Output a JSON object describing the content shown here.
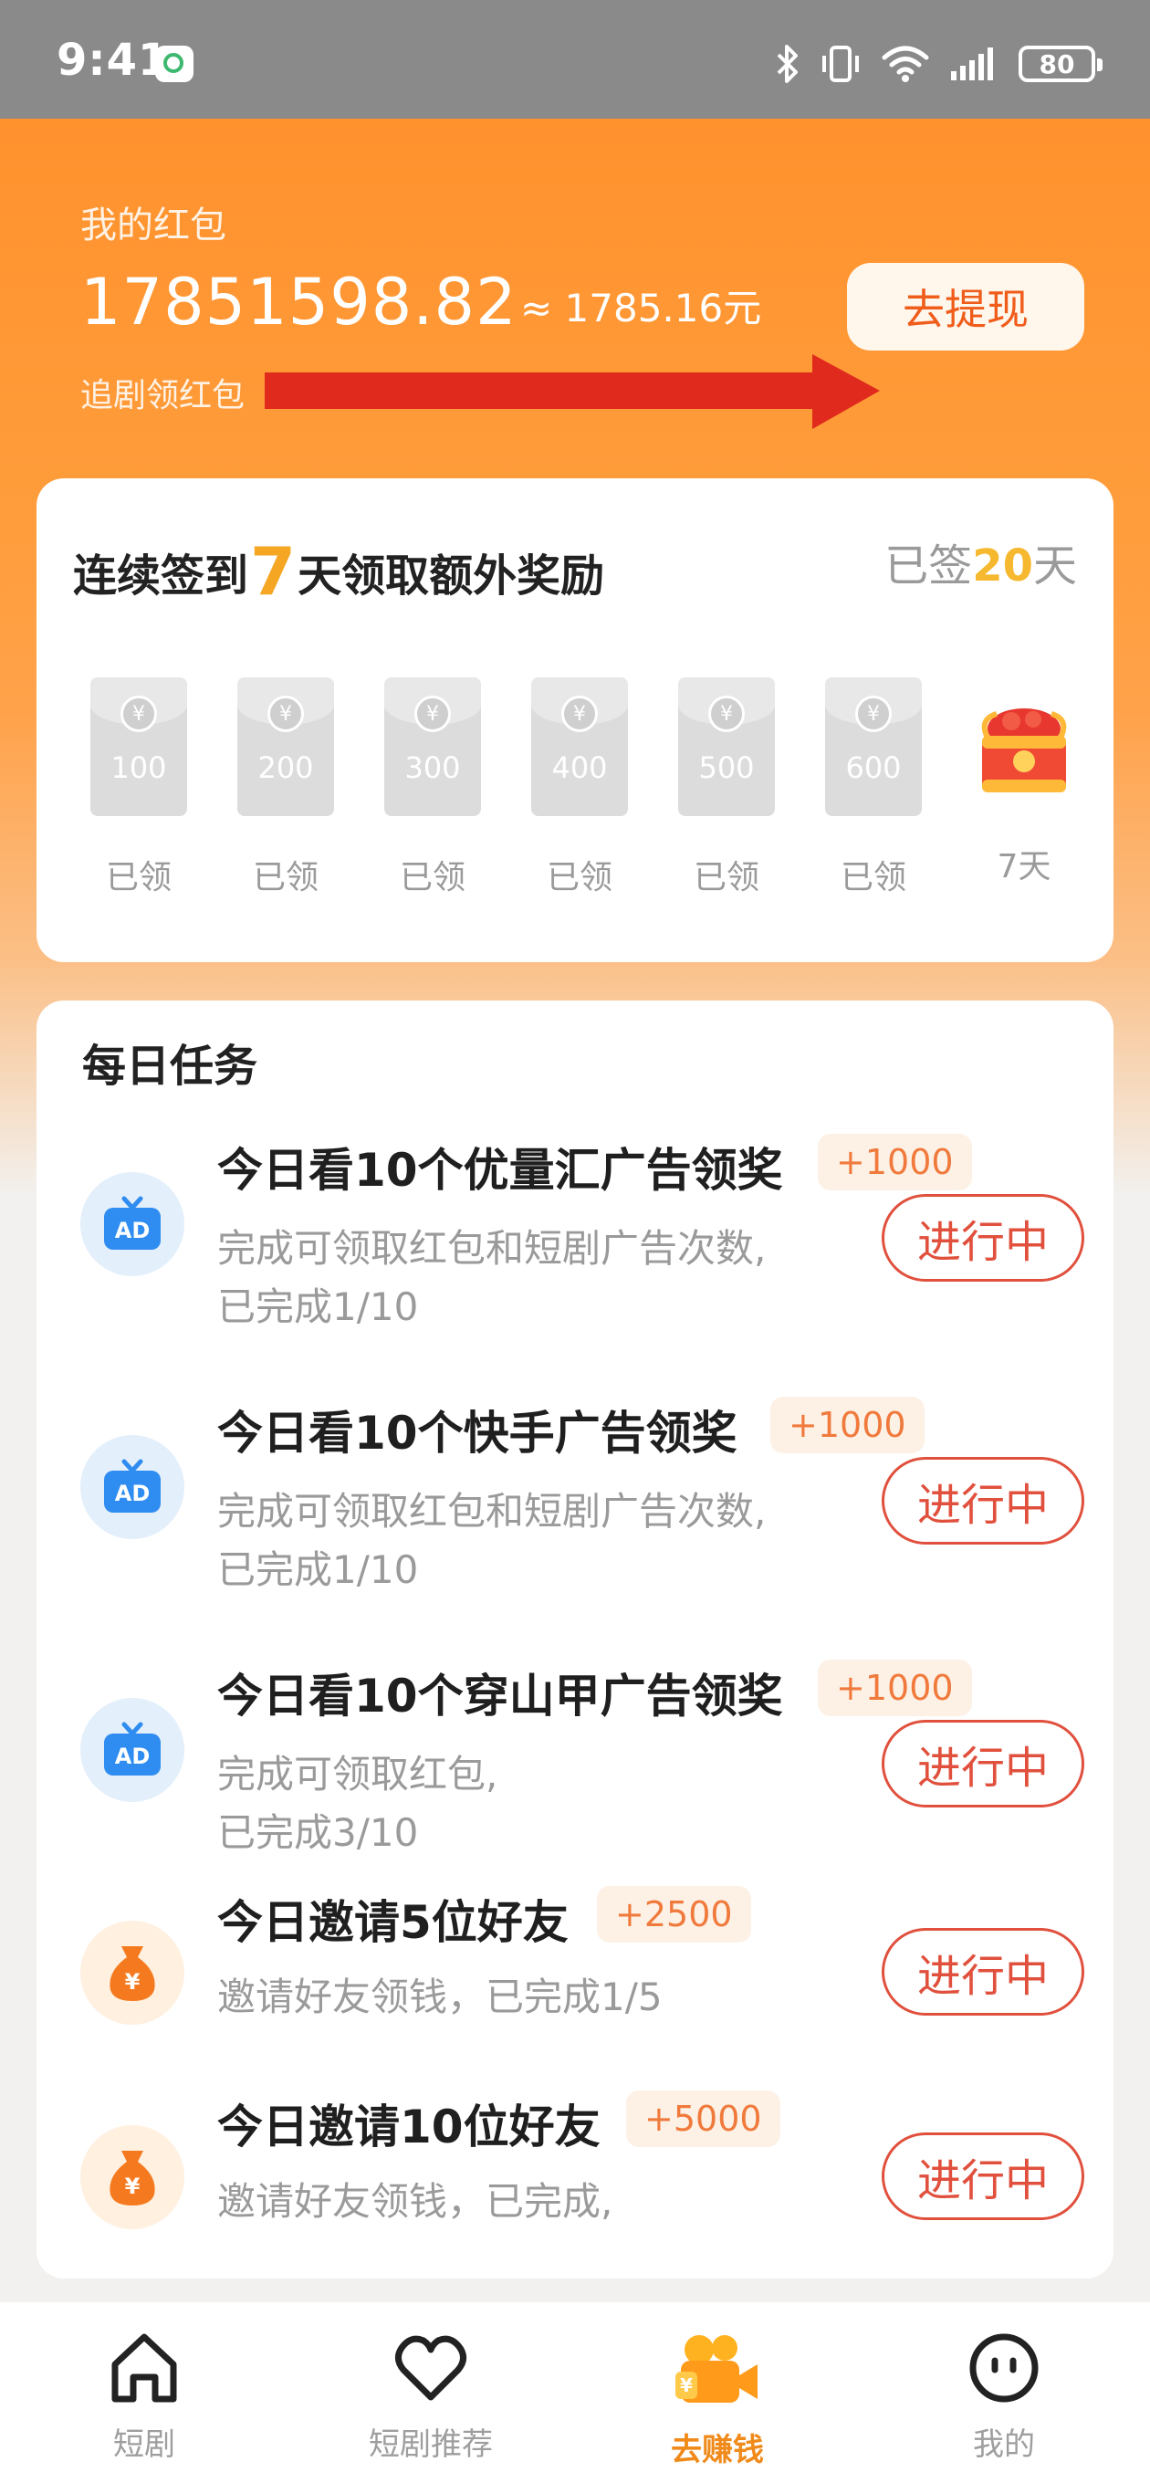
{
  "status_bar": {
    "time": "9:41",
    "battery": "80"
  },
  "wallet": {
    "title": "我的红包",
    "amount": "17851598.82",
    "approx": "≈ 1785.16元",
    "withdraw_label": "去提现",
    "subtitle": "追剧领红包"
  },
  "checkin": {
    "title_prefix": "连续签到",
    "title_number": "7",
    "title_suffix": "天领取额外奖励",
    "status_prefix": "已签",
    "status_days": "20",
    "status_suffix": "天",
    "days": [
      {
        "amount": "100",
        "label": "已领"
      },
      {
        "amount": "200",
        "label": "已领"
      },
      {
        "amount": "300",
        "label": "已领"
      },
      {
        "amount": "400",
        "label": "已领"
      },
      {
        "amount": "500",
        "label": "已领"
      },
      {
        "amount": "600",
        "label": "已领"
      },
      {
        "amount": "",
        "label": "7天"
      }
    ]
  },
  "tasks": {
    "header": "每日任务",
    "items": [
      {
        "icon": "ad-tv-icon",
        "title": "今日看10个优量汇广告领奖",
        "reward": "+1000",
        "desc1": "完成可领取红包和短剧广告次数,",
        "desc2": "已完成1/10",
        "button": "进行中"
      },
      {
        "icon": "ad-tv-icon",
        "title": "今日看10个快手广告领奖",
        "reward": "+1000",
        "desc1": "完成可领取红包和短剧广告次数,",
        "desc2": "已完成1/10",
        "button": "进行中"
      },
      {
        "icon": "ad-tv-icon",
        "title": "今日看10个穿山甲广告领奖",
        "reward": "+1000",
        "desc1": "完成可领取红包,",
        "desc2": "已完成3/10",
        "button": "进行中"
      },
      {
        "icon": "money-bag-icon",
        "title": "今日邀请5位好友",
        "reward": "+2500",
        "desc1": "邀请好友领钱，已完成1/5",
        "desc2": "",
        "button": "进行中"
      },
      {
        "icon": "money-bag-icon",
        "title": "今日邀请10位好友",
        "reward": "+5000",
        "desc1": "邀请好友领钱，已完成,",
        "desc2": "",
        "button": "进行中"
      }
    ]
  },
  "nav": {
    "items": [
      {
        "label": "短剧",
        "icon": "home-icon"
      },
      {
        "label": "短剧推荐",
        "icon": "heart-icon"
      },
      {
        "label": "去赚钱",
        "icon": "earn-camera-icon",
        "active": true
      },
      {
        "label": "我的",
        "icon": "face-icon"
      }
    ]
  },
  "colors": {
    "accent_orange": "#ff922d",
    "progress_red": "#e0503d",
    "gold": "#f5a623"
  }
}
